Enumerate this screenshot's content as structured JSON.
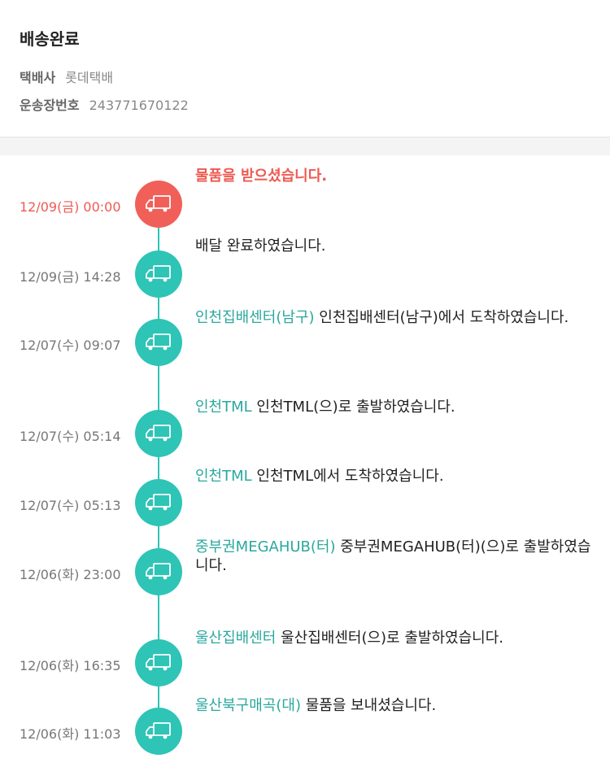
{
  "header": {
    "status_title": "배송완료",
    "courier_label": "택배사",
    "courier_value": "롯데택배",
    "tracking_label": "운송장번호",
    "tracking_value": "243771670122"
  },
  "colors": {
    "accent": "#2ec4b6",
    "location_text": "#2aa89d",
    "highlight": "#f06058"
  },
  "timeline": {
    "icon": "delivery-truck-icon",
    "events": [
      {
        "time": "12/09(금) 00:00",
        "location": "",
        "message": "물품을 받으셨습니다."
      },
      {
        "time": "12/09(금) 14:28",
        "location": "",
        "message": "배달 완료하였습니다."
      },
      {
        "time": "12/07(수) 09:07",
        "location": "인천집배센터(남구)",
        "message": "인천집배센터(남구)에서 도착하였습니다."
      },
      {
        "time": "12/07(수) 05:14",
        "location": "인천TML",
        "message": "인천TML(으)로 출발하였습니다."
      },
      {
        "time": "12/07(수) 05:13",
        "location": "인천TML",
        "message": "인천TML에서 도착하였습니다."
      },
      {
        "time": "12/06(화) 23:00",
        "location": "중부권MEGAHUB(터)",
        "message": "중부권MEGAHUB(터)(으)로 출발하였습니다."
      },
      {
        "time": "12/06(화) 16:35",
        "location": "울산집배센터",
        "message": "울산집배센터(으)로 출발하였습니다."
      },
      {
        "time": "12/06(화) 11:03",
        "location": "울산북구매곡(대)",
        "message": "물품을 보내셨습니다."
      }
    ]
  }
}
